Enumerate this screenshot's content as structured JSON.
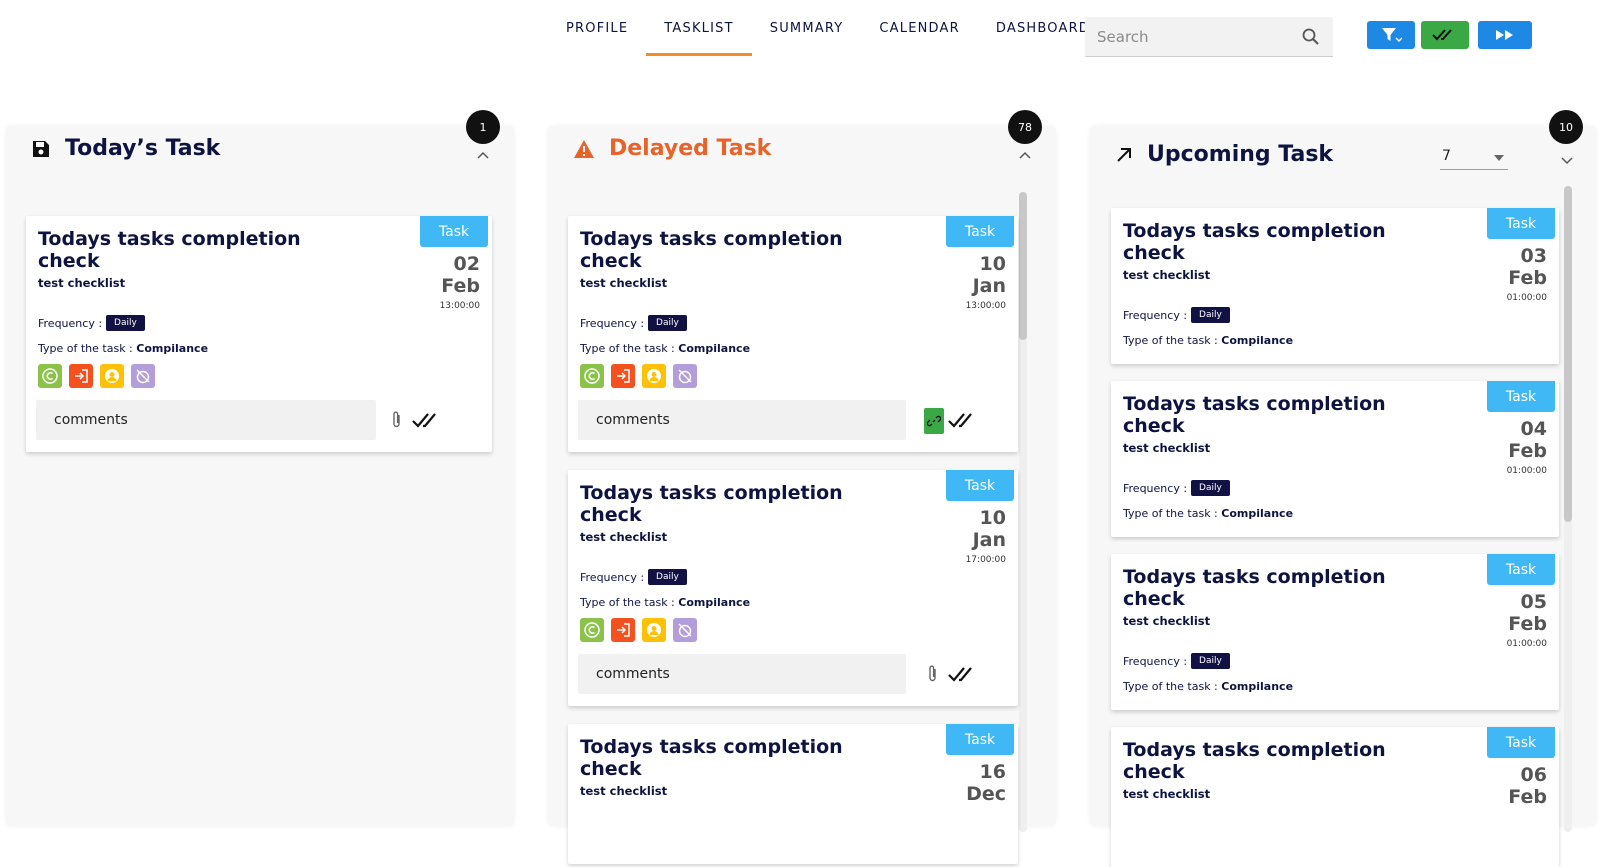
{
  "nav": {
    "tabs": [
      {
        "label": "PROFILE"
      },
      {
        "label": "TASKLIST",
        "active": true
      },
      {
        "label": "SUMMARY"
      },
      {
        "label": "CALENDAR"
      },
      {
        "label": "DASHBOARD"
      }
    ]
  },
  "search": {
    "placeholder": "Search",
    "icon": "search-icon"
  },
  "toolbar": {
    "buttons": [
      {
        "icon": "filter-icon",
        "color": "#1e88e5"
      },
      {
        "icon": "double-check-icon",
        "color": "#3aa845"
      },
      {
        "icon": "fast-forward-icon",
        "color": "#1e88e5"
      }
    ]
  },
  "colors": {
    "accent": "#f28c28",
    "tag": "#3fb8f5",
    "delayed": "#e8632a",
    "navy": "#0e1440"
  },
  "columns": [
    {
      "title": "Today’s Task",
      "count": "1",
      "icon": "save-icon",
      "cards": [
        {
          "tag": "Task",
          "title": "Todays tasks completion check",
          "subtitle": "test checklist",
          "day": "02",
          "month": "Feb",
          "time": "13:00:00",
          "frequency_label": "Frequency :",
          "frequency": "Daily",
          "type_label": "Type of the task :",
          "type": "Compilance",
          "comment": "comments"
        }
      ]
    },
    {
      "title": "Delayed Task",
      "count": "78",
      "icon": "warning-icon",
      "cards": [
        {
          "tag": "Task",
          "title": "Todays tasks completion check",
          "subtitle": "test checklist",
          "day": "10",
          "month": "Jan",
          "time": "13:00:00",
          "frequency_label": "Frequency :",
          "frequency": "Daily",
          "type_label": "Type of the task :",
          "type": "Compilance",
          "comment": "comments"
        },
        {
          "tag": "Task",
          "title": "Todays tasks completion check",
          "subtitle": "test checklist",
          "day": "10",
          "month": "Jan",
          "time": "17:00:00",
          "frequency_label": "Frequency :",
          "frequency": "Daily",
          "type_label": "Type of the task :",
          "type": "Compilance",
          "comment": "comments"
        },
        {
          "tag": "Task",
          "title": "Todays tasks completion check",
          "subtitle": "test checklist",
          "day": "16",
          "month": "Dec"
        }
      ]
    },
    {
      "title": "Upcoming Task",
      "count": "10",
      "icon": "arrow-up-right-icon",
      "range": "7",
      "cards": [
        {
          "tag": "Task",
          "title": "Todays tasks completion check",
          "subtitle": "test checklist",
          "day": "03",
          "month": "Feb",
          "time": "01:00:00",
          "frequency_label": "Frequency :",
          "frequency": "Daily",
          "type_label": "Type of the task :",
          "type": "Compilance"
        },
        {
          "tag": "Task",
          "title": "Todays tasks completion check",
          "subtitle": "test checklist",
          "day": "04",
          "month": "Feb",
          "time": "01:00:00",
          "frequency_label": "Frequency :",
          "frequency": "Daily",
          "type_label": "Type of the task :",
          "type": "Compilance"
        },
        {
          "tag": "Task",
          "title": "Todays tasks completion check",
          "subtitle": "test checklist",
          "day": "05",
          "month": "Feb",
          "time": "01:00:00",
          "frequency_label": "Frequency :",
          "frequency": "Daily",
          "type_label": "Type of the task :",
          "type": "Compilance"
        },
        {
          "tag": "Task",
          "title": "Todays tasks completion check",
          "subtitle": "test checklist",
          "day": "06",
          "month": "Feb"
        }
      ]
    }
  ]
}
